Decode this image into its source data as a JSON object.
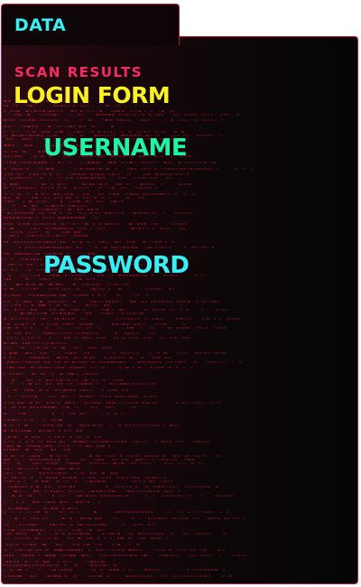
{
  "tab": {
    "label": "DATA"
  },
  "panel": {
    "subtitle": "SCAN RESULTS",
    "title": "LOGIN FORM"
  },
  "form": {
    "username_label": "USERNAME",
    "username_value": "",
    "password_label": "PASSWORD",
    "password_value": ""
  },
  "colors": {
    "border": "#b81a3c",
    "tab_label": "#37f0f7",
    "subtitle": "#ff2a63",
    "title": "#fbf024",
    "username_label": "#1ef5a4",
    "password_label": "#37f0f7",
    "noise": "#c61c3d"
  }
}
